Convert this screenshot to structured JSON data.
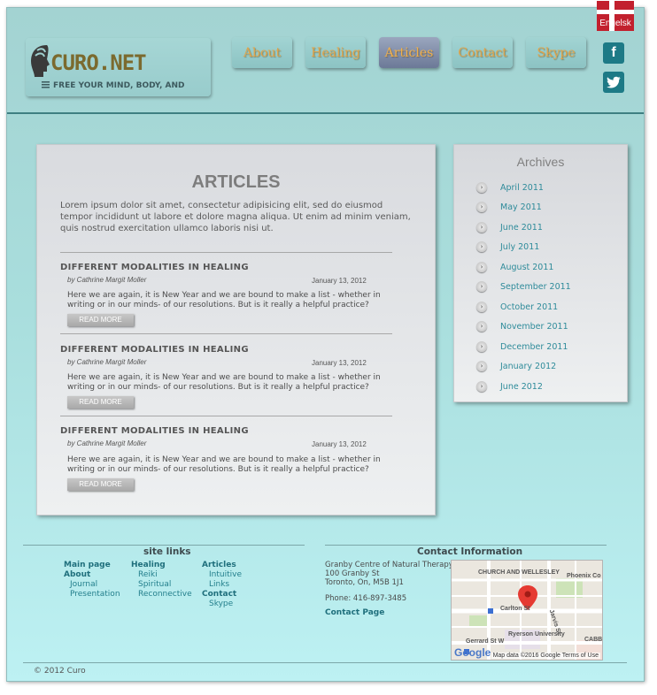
{
  "header": {
    "logo_title": "CURO.NET",
    "logo_tagline": "FREE YOUR MIND, BODY, AND",
    "language_label": "Engelsk",
    "nav": [
      {
        "label": "About",
        "active": false
      },
      {
        "label": "Healing",
        "active": false
      },
      {
        "label": "Articles",
        "active": true
      },
      {
        "label": "Contact",
        "active": false
      },
      {
        "label": "Skype",
        "active": false
      }
    ],
    "social": {
      "facebook": "f",
      "twitter": "🐦"
    }
  },
  "articles": {
    "title": "ARTICLES",
    "intro": "Lorem ipsum dolor sit amet, consectetur adipisicing elit, sed do eiusmod tempor incididunt ut labore et dolore magna aliqua. Ut enim ad minim veniam, quis nostrud exercitation ullamco laboris nisi ut.",
    "posts": [
      {
        "title": "DIFFERENT MODALITIES IN HEALING",
        "author": "by Cathrine Margit Moller",
        "date": "January 13, 2012",
        "excerpt": "Here we are again, it is New Year and we are bound to make a list - whether in writing or in our minds- of our resolutions. But is it really a helpful practice?",
        "button": "READ MORE"
      },
      {
        "title": "DIFFERENT MODALITIES IN HEALING",
        "author": "by Cathrine Margit Moller",
        "date": "January 13, 2012",
        "excerpt": "Here we are again, it is New Year and we are bound to make a list - whether in writing or in our minds- of our resolutions. But is it really a helpful practice?",
        "button": "READ MORE"
      },
      {
        "title": "DIFFERENT MODALITIES IN HEALING",
        "author": "by Cathrine Margit Moller",
        "date": "January 13, 2012",
        "excerpt": "Here we are again, it is New Year and we are bound to make a list - whether in writing or in our minds- of our resolutions. But is it really a helpful practice?",
        "button": "READ MORE"
      }
    ]
  },
  "archives": {
    "title": "Archives",
    "items": [
      "April 2011",
      "May 2011",
      "June 2011",
      "July 2011",
      "August 2011",
      "September 2011",
      "October 2011",
      "November 2011",
      "December 2011",
      "January 2012",
      "June 2012"
    ]
  },
  "footer": {
    "site_links_title": "site links",
    "col1": {
      "main": "Main page",
      "about": "About",
      "journal": "Journal",
      "presentation": "Presentation"
    },
    "col2": {
      "healing": "Healing",
      "reiki": "Reiki",
      "spiritual": "Spiritual",
      "reconnective": "Reconnective"
    },
    "col3": {
      "articles": "Articles",
      "intuitive": "Intuitive",
      "links": "Links",
      "contact": "Contact",
      "skype": "Skype"
    },
    "contact_title": "Contact Information",
    "address1": "Granby Centre of Natural Therapy",
    "address2": "100 Granby St",
    "address3": "Toronto, On, M5B 1J1",
    "phone": "Phone: 416-897-3485",
    "contact_page": "Contact Page",
    "map": {
      "labels": [
        "CHURCH AND WELLESLEY",
        "Phoenix Co",
        "Carlton St",
        "Ryerson University",
        "Jarvis St",
        "Gerrard St W",
        "CABB"
      ],
      "google": "Google",
      "credit": "Map data ©2016 Google  Terms of Use"
    },
    "copyright": "© 2012 Curo"
  },
  "colors": {
    "accent": "#e0a44a",
    "link": "#2e8b9a",
    "header_rule": "#3e7f82",
    "flag": "#c2202e"
  }
}
